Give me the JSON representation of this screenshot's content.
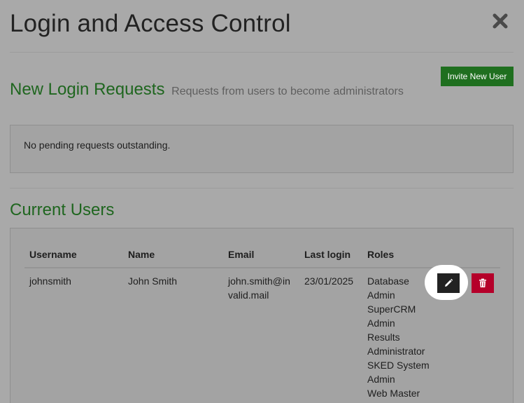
{
  "page": {
    "title": "Login and Access Control"
  },
  "actions": {
    "invite_label": "Invite New User"
  },
  "requests": {
    "heading": "New Login Requests",
    "subheading": "Requests from users to become administrators",
    "empty_message": "No pending requests outstanding."
  },
  "users": {
    "heading": "Current Users",
    "columns": [
      "Username",
      "Name",
      "Email",
      "Last login",
      "Roles"
    ],
    "rows": [
      {
        "username": "johnsmith",
        "name": "John Smith",
        "email": "john.smith@invalid.mail",
        "last_login": "23/01/2025",
        "roles": [
          "Database Admin",
          "SuperCRM Admin",
          "Results Administrator",
          "SKED System Admin",
          "Web Master"
        ]
      }
    ]
  },
  "icons": {
    "close": "close-icon",
    "edit": "pencil-icon",
    "delete": "trash-icon"
  },
  "colors": {
    "accent_green": "#1f6f1f",
    "heading_green": "#1f661f",
    "danger_red": "#b5002a",
    "edit_dark": "#222222"
  }
}
